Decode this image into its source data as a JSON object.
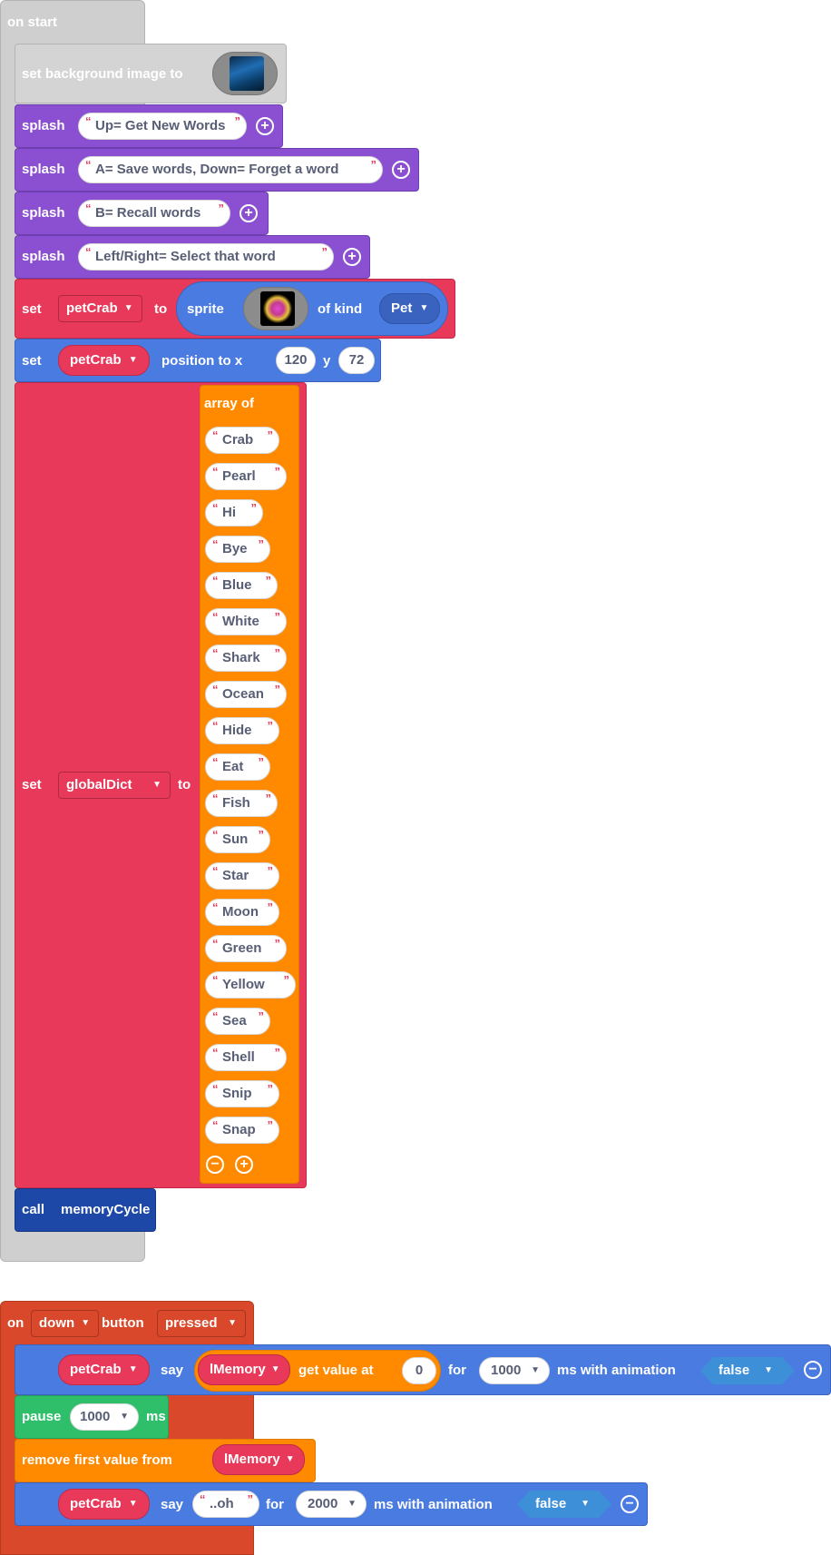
{
  "on_start": {
    "label": "on start",
    "set_background": "set background image to",
    "splash_label": "splash",
    "splashes": [
      "Up= Get New Words",
      "A= Save words, Down= Forget a word",
      "B= Recall words",
      "Left/Right= Select that word"
    ],
    "set_label": "set",
    "to_label": "to",
    "pet_var": "petCrab",
    "sprite_label": "sprite",
    "of_kind_label": "of kind",
    "kind": "Pet",
    "position_label": "position to x",
    "x": "120",
    "y_label": "y",
    "y": "72",
    "dict_var": "globalDict",
    "array_label": "array of",
    "words": [
      "Crab",
      "Pearl",
      "Hi",
      "Bye",
      "Blue",
      "White",
      "Shark",
      "Ocean",
      "Hide",
      "Eat",
      "Fish",
      "Sun",
      "Star",
      "Moon",
      "Green",
      "Yellow",
      "Sea",
      "Shell",
      "Snip",
      "Snap"
    ],
    "call_label": "call",
    "call_fn": "memoryCycle"
  },
  "on_button": {
    "on_label": "on",
    "button_name": "down",
    "button_label": "button",
    "event": "pressed",
    "pet_var": "petCrab",
    "say_label": "say",
    "memory_var": "lMemory",
    "get_value_label": "get value at",
    "index": "0",
    "for_label": "for",
    "ms1": "1000",
    "ms_anim_label": "ms with animation",
    "anim1": "false",
    "pause_label": "pause",
    "pause_ms": "1000",
    "ms_label": "ms",
    "remove_label": "remove first value from",
    "say2_text": "..oh",
    "ms2": "2000",
    "anim2": "false"
  },
  "colors": {
    "hat": "#cfcfcf",
    "scene": "#cfcfcf",
    "text": "#8b4fd1",
    "variables": "#e8395a",
    "sprites": "#4a7be0",
    "functions": "#1e48a8",
    "arrays": "#ff8a00",
    "loops": "#2fbf6b",
    "controller": "#d9482a"
  },
  "icons": [
    "add-circle-icon",
    "remove-circle-icon",
    "dropdown-caret-icon",
    "image-thumbnail-icon"
  ]
}
